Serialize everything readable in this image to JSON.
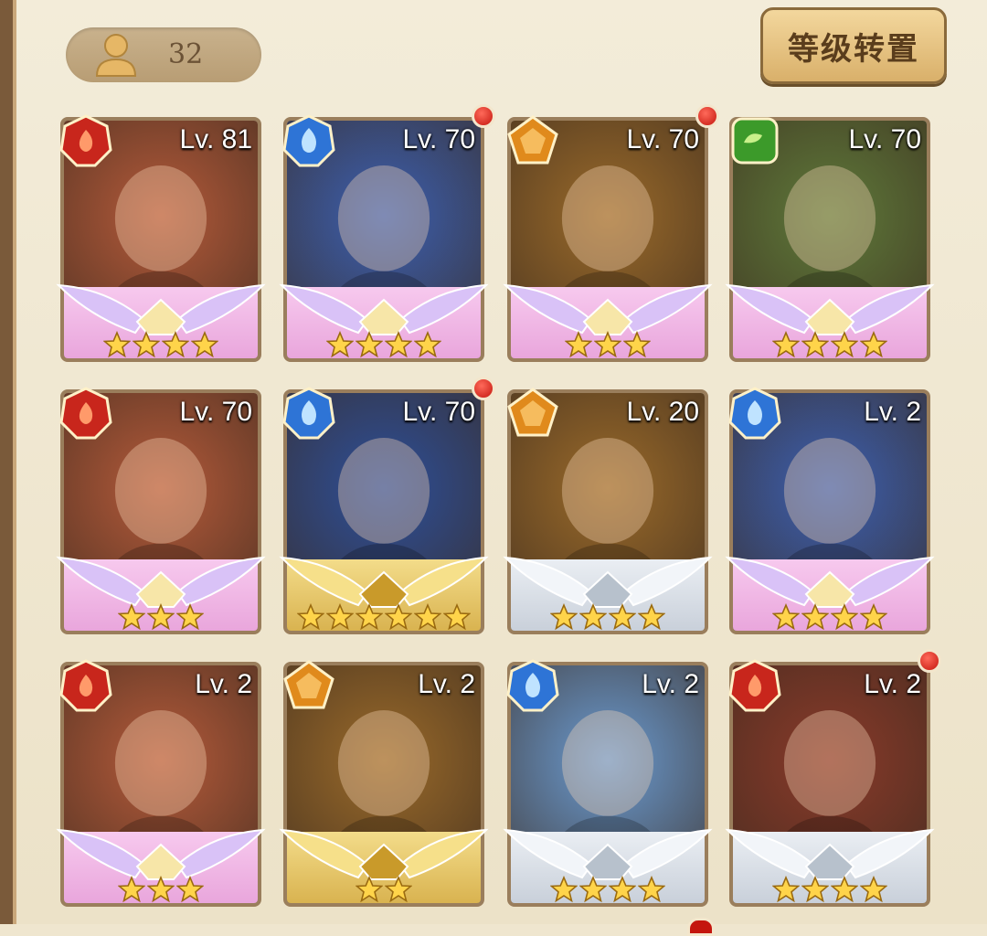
{
  "header": {
    "hero_count": "32",
    "sort_button_label": "等级转置"
  },
  "colors": {
    "fire": "#c8261c",
    "water": "#2e74d6",
    "earth": "#e08a1c",
    "nature": "#3c9a2a",
    "notification": "#d9281a"
  },
  "cards": [
    {
      "level": "Lv. 81",
      "element": "fire",
      "stars": 4,
      "rarity": "pink",
      "bg": "#b55a3a",
      "notif": false
    },
    {
      "level": "Lv. 70",
      "element": "water",
      "stars": 4,
      "rarity": "pink",
      "bg": "#3b5fb0",
      "notif": true
    },
    {
      "level": "Lv. 70",
      "element": "earth",
      "stars": 3,
      "rarity": "pink",
      "bg": "#9a6a2a",
      "notif": true
    },
    {
      "level": "Lv. 70",
      "element": "nature",
      "stars": 4,
      "rarity": "pink",
      "bg": "#5f7a3a",
      "notif": false
    },
    {
      "level": "Lv. 70",
      "element": "fire",
      "stars": 3,
      "rarity": "pink",
      "bg": "#b55a3a",
      "notif": false
    },
    {
      "level": "Lv. 70",
      "element": "water",
      "stars": 6,
      "rarity": "gold",
      "bg": "#2d4f9a",
      "notif": true
    },
    {
      "level": "Lv. 20",
      "element": "earth",
      "stars": 4,
      "rarity": "silver",
      "bg": "#9a6a2a",
      "notif": false
    },
    {
      "level": "Lv. 2",
      "element": "water",
      "stars": 4,
      "rarity": "pink",
      "bg": "#3b5fb0",
      "notif": false
    },
    {
      "level": "Lv. 2",
      "element": "fire",
      "stars": 3,
      "rarity": "pink",
      "bg": "#b55a3a",
      "notif": false
    },
    {
      "level": "Lv. 2",
      "element": "earth",
      "stars": 2,
      "rarity": "gold",
      "bg": "#9a6a2a",
      "notif": false
    },
    {
      "level": "Lv. 2",
      "element": "water",
      "stars": 4,
      "rarity": "silver",
      "bg": "#6a9ad0",
      "notif": false
    },
    {
      "level": "Lv. 2",
      "element": "fire",
      "stars": 4,
      "rarity": "silver",
      "bg": "#8a3a2a",
      "notif": true
    }
  ]
}
